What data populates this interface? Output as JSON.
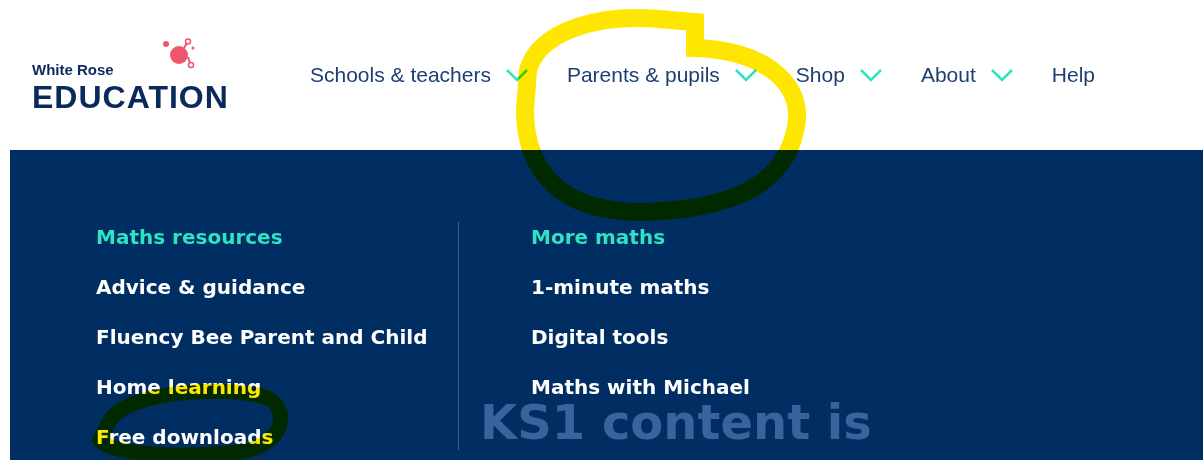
{
  "logo": {
    "line_1": "White Rose",
    "line_2": "EDUCATION"
  },
  "nav": [
    {
      "label": "Schools & teachers",
      "dropdown": true
    },
    {
      "label": "Parents & pupils",
      "dropdown": true
    },
    {
      "label": "Shop",
      "dropdown": true
    },
    {
      "label": "About",
      "dropdown": true
    },
    {
      "label": "Help",
      "dropdown": false
    }
  ],
  "menu": {
    "columns": [
      {
        "heading": "Maths resources",
        "links": [
          "Advice & guidance",
          "Fluency Bee Parent and Child",
          "Home learning",
          "Free downloads"
        ]
      },
      {
        "heading": "More maths",
        "links": [
          "1-minute maths",
          "Digital tools",
          "Maths with Michael"
        ]
      }
    ],
    "background_text": "KS1 content is"
  }
}
